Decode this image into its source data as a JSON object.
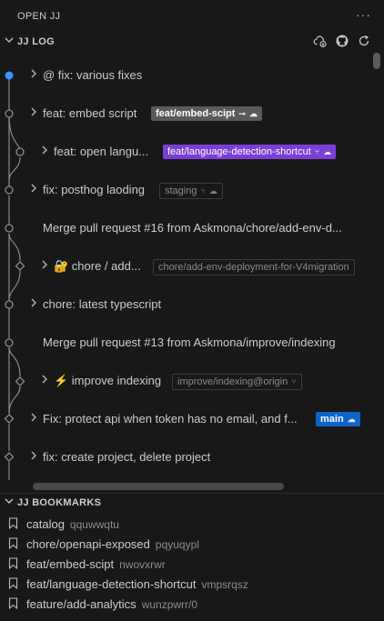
{
  "panel": {
    "title": "OPEN JJ",
    "more": "···"
  },
  "log": {
    "title": "JJ LOG",
    "rows": [
      {
        "desc": "@ fix: various fixes",
        "expandable": true
      },
      {
        "desc": "feat: embed script",
        "expandable": true,
        "badge": {
          "text": "feat/embed-scipt",
          "style": "grey",
          "icons": [
            "commit-icon",
            "cloud-icon"
          ]
        }
      },
      {
        "desc": "feat: open langu...",
        "expandable": true,
        "badge": {
          "text": "feat/language-detection-shortcut",
          "style": "purple",
          "icons": [
            "fork-icon",
            "cloud-icon"
          ]
        }
      },
      {
        "desc": "fix: posthog laoding",
        "expandable": true,
        "badge": {
          "text": "staging",
          "style": "outline",
          "icons": [
            "fork-icon",
            "cloud-icon"
          ]
        }
      },
      {
        "desc": "Merge pull request #16 from Askmona/chore/add-env-d...",
        "expandable": false
      },
      {
        "desc": "🔐 chore / add...",
        "expandable": true,
        "badge": {
          "text": "chore/add-env-deployment-for-V4migration",
          "style": "outline",
          "icons": []
        }
      },
      {
        "desc": "chore: latest typescript",
        "expandable": true
      },
      {
        "desc": "Merge pull request #13 from Askmona/improve/indexing",
        "expandable": false
      },
      {
        "desc": "⚡ improve indexing",
        "expandable": true,
        "badge": {
          "text": "improve/indexing@origin",
          "style": "outline",
          "icons": [
            "fork-icon"
          ]
        }
      },
      {
        "desc": "Fix: protect api when token has no email, and f...",
        "expandable": true,
        "badge": {
          "text": "main",
          "style": "blue",
          "icons": [
            "cloud-icon"
          ]
        }
      },
      {
        "desc": "fix: create project, delete project",
        "expandable": true
      }
    ]
  },
  "bookmarks": {
    "title": "JJ BOOKMARKS",
    "items": [
      {
        "name": "catalog",
        "id": "qquwwqtu"
      },
      {
        "name": "chore/openapi-exposed",
        "id": "pqyuqypl"
      },
      {
        "name": "feat/embed-scipt",
        "id": "nwovxrwr"
      },
      {
        "name": "feat/language-detection-shortcut",
        "id": "vmpsrqsz"
      },
      {
        "name": "feature/add-analytics",
        "id": "wunzpwrr/0"
      }
    ]
  },
  "colors": {
    "working_copy": "#3794ff",
    "graph": "#8a8a8a",
    "background": "#181818"
  }
}
